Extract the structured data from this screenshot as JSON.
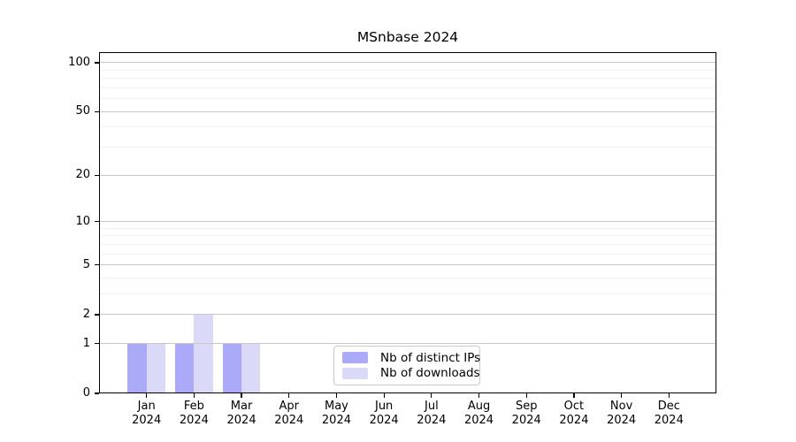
{
  "chart_data": {
    "type": "bar",
    "title": "MSnbase 2024",
    "categories": [
      "Jan",
      "Feb",
      "Mar",
      "Apr",
      "May",
      "Jun",
      "Jul",
      "Aug",
      "Sep",
      "Oct",
      "Nov",
      "Dec"
    ],
    "category_year": "2024",
    "series": [
      {
        "name": "Nb of distinct IPs",
        "color": "#aaaaf8",
        "values": [
          1,
          1,
          1,
          0,
          0,
          0,
          0,
          0,
          0,
          0,
          0,
          0
        ]
      },
      {
        "name": "Nb of downloads",
        "color": "#dadaf8",
        "values": [
          1,
          2,
          1,
          0,
          0,
          0,
          0,
          0,
          0,
          0,
          0,
          0
        ]
      }
    ],
    "xlabel": "",
    "ylabel": "",
    "y_axis": {
      "scale": "log1p",
      "tick_labels": [
        0,
        1,
        2,
        5,
        10,
        20,
        50,
        100
      ],
      "minor_gridlines": [
        3,
        4,
        6,
        7,
        8,
        9,
        30,
        40,
        60,
        70,
        80,
        90
      ],
      "ylim": [
        0,
        116
      ]
    },
    "grid": true,
    "legend": {
      "position": "inside-bottom-center"
    },
    "colors": {
      "major_grid": "#c8c8c8",
      "minor_grid": "#f0f0f0",
      "spine": "#000000",
      "background": "#ffffff",
      "text": "#000000"
    }
  }
}
